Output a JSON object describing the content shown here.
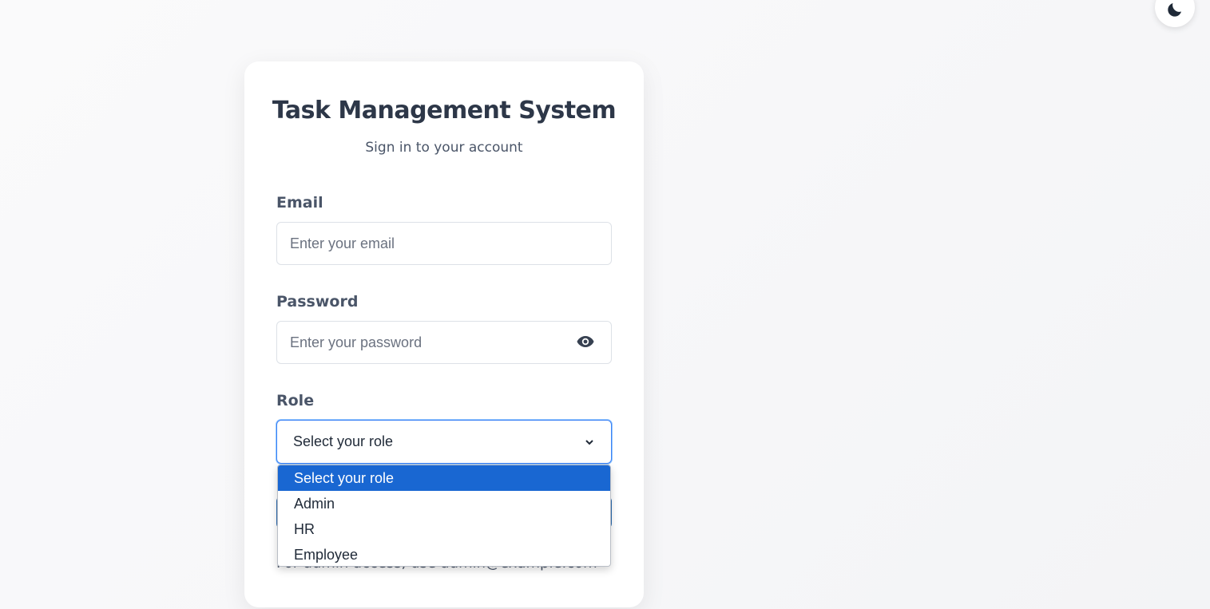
{
  "colors": {
    "primary": "#2b6cb0",
    "highlight": "#1967d2",
    "heading": "#2d3748",
    "focus_border": "#3b82f6"
  },
  "theme_toggle": {
    "icon": "moon-icon"
  },
  "login": {
    "title": "Task Management System",
    "subtitle": "Sign in to your account",
    "email": {
      "label": "Email",
      "placeholder": "Enter your email",
      "value": ""
    },
    "password": {
      "label": "Password",
      "placeholder": "Enter your password",
      "value": "",
      "toggle_icon": "eye-icon"
    },
    "role": {
      "label": "Role",
      "selected": "Select your role",
      "options": [
        "Select your role",
        "Admin",
        "HR",
        "Employee"
      ],
      "highlighted_index": 0
    },
    "hint": "For admin access, use admin@example.com"
  }
}
